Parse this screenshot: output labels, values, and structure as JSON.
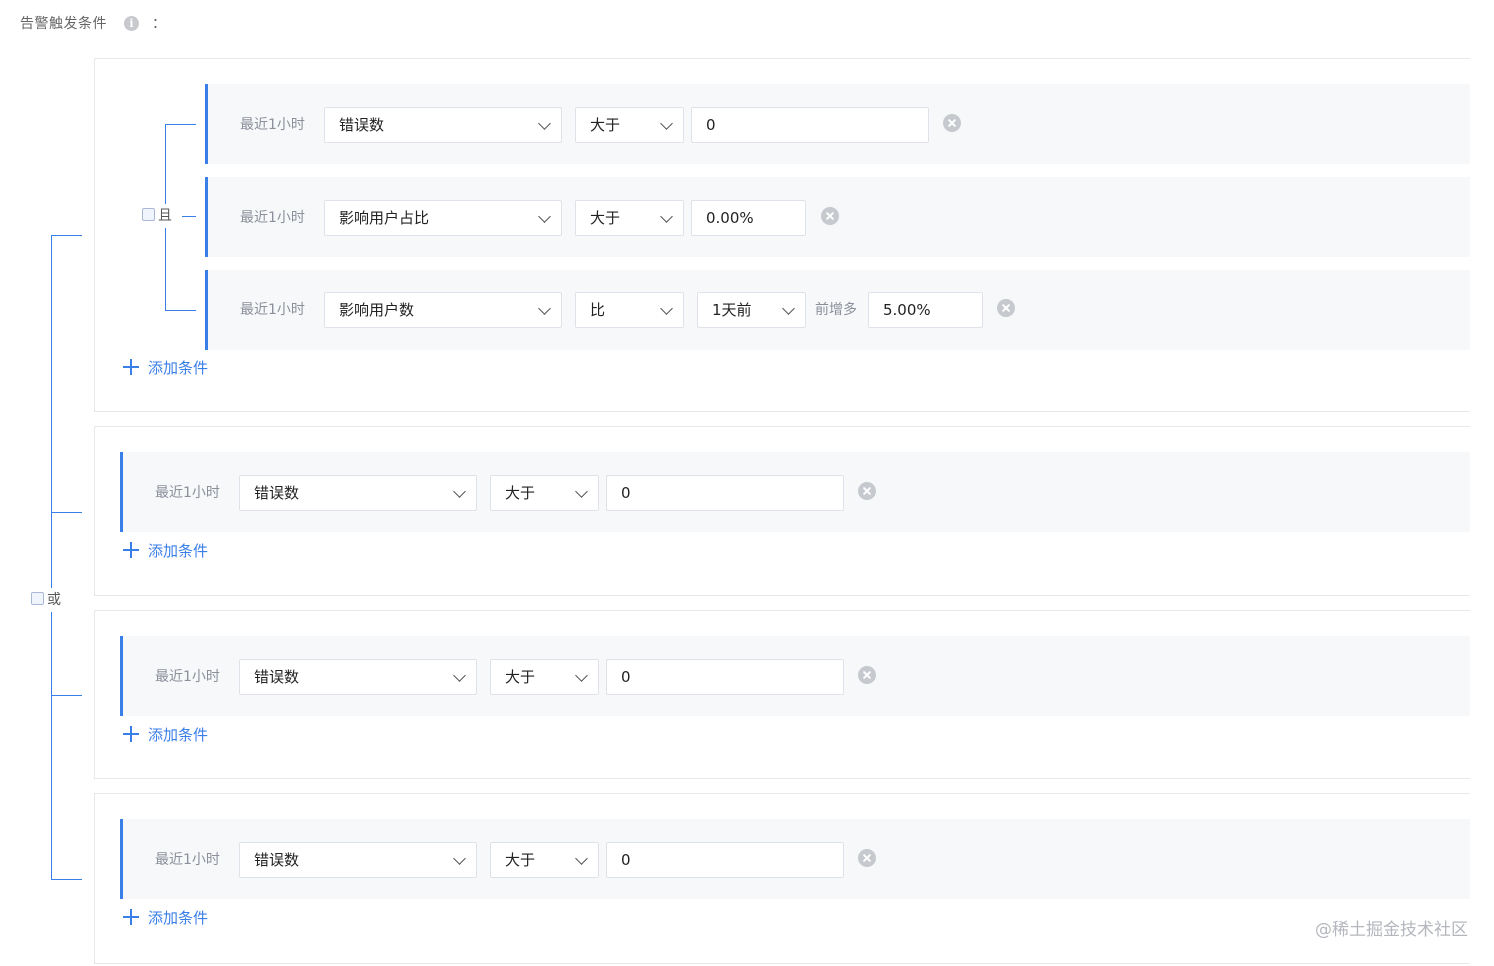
{
  "header": {
    "title": "告警触发条件",
    "info_icon": "info-icon",
    "colon": "："
  },
  "logic": {
    "or_label": "或",
    "and_label": "且"
  },
  "groups": [
    {
      "rows": [
        {
          "time": "最近1小时",
          "metric": "错误数",
          "operator": "大于",
          "value": "0"
        },
        {
          "time": "最近1小时",
          "metric": "影响用户占比",
          "operator": "大于",
          "value": "0.00%"
        },
        {
          "time": "最近1小时",
          "metric": "影响用户数",
          "operator": "比",
          "compare": "1天前",
          "change_label": "前增多",
          "value": "5.00%"
        }
      ],
      "add_label": "添加条件"
    },
    {
      "rows": [
        {
          "time": "最近1小时",
          "metric": "错误数",
          "operator": "大于",
          "value": "0"
        }
      ],
      "add_label": "添加条件"
    },
    {
      "rows": [
        {
          "time": "最近1小时",
          "metric": "错误数",
          "operator": "大于",
          "value": "0"
        }
      ],
      "add_label": "添加条件"
    },
    {
      "rows": [
        {
          "time": "最近1小时",
          "metric": "错误数",
          "operator": "大于",
          "value": "0"
        }
      ],
      "add_label": "添加条件"
    }
  ],
  "watermark": "@稀土掘金技术社区",
  "colors": {
    "accent": "#3a7ee8",
    "row_bg": "#f7f8fa",
    "border": "#e6e8ee"
  }
}
